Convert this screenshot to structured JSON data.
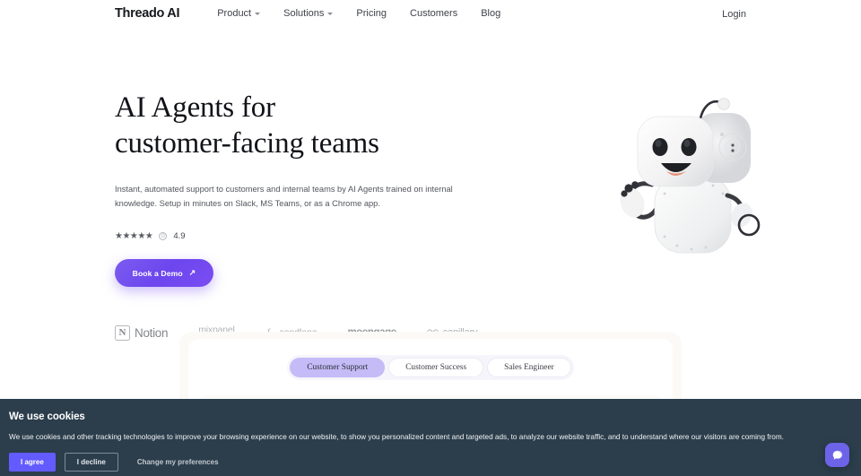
{
  "nav": {
    "brand": "Threado AI",
    "links": [
      {
        "label": "Product",
        "has_caret": true
      },
      {
        "label": "Solutions",
        "has_caret": true
      },
      {
        "label": "Pricing",
        "has_caret": false
      },
      {
        "label": "Customers",
        "has_caret": false
      },
      {
        "label": "Blog",
        "has_caret": false
      }
    ],
    "login": "Login"
  },
  "hero": {
    "headline_line1": "AI Agents for",
    "headline_line2": "customer-facing teams",
    "subcopy": "Instant, automated support to customers and internal teams by AI Agents trained on internal knowledge. Setup in minutes on Slack, MS Teams, or as a Chrome app.",
    "rating": {
      "stars": "★★★★★",
      "badge": "g2-icon",
      "value": "4.9"
    },
    "cta": {
      "label": "Book a Demo",
      "arrow": "↗"
    },
    "robot_alt": "robot-mascot"
  },
  "logos": [
    {
      "name": "Notion",
      "mark": "N"
    },
    {
      "name": "mixpanel"
    },
    {
      "name": "sendlane"
    },
    {
      "name": "moengage"
    },
    {
      "name": "capillary"
    }
  ],
  "product_card": {
    "tabs": [
      {
        "label": "Customer Support",
        "active": true
      },
      {
        "label": "Customer Success",
        "active": false
      },
      {
        "label": "Sales Engineer",
        "active": false
      }
    ]
  },
  "cookie": {
    "title": "We use cookies",
    "body": "We use cookies and other tracking technologies to improve your browsing experience on our website, to show you personalized content and targeted ads, to analyze our website traffic, and to understand where our visitors are coming from.",
    "agree": "I agree",
    "decline": "I decline",
    "preferences": "Change my preferences"
  },
  "chat": {
    "icon": "chat-bubble-icon"
  },
  "colors": {
    "accent_purple": "#6d46ee",
    "cookie_bg": "#2c3e4c",
    "agree_btn": "#635bff",
    "tab_active": "#c4bbf7",
    "chat_bg": "#6c63e8"
  }
}
